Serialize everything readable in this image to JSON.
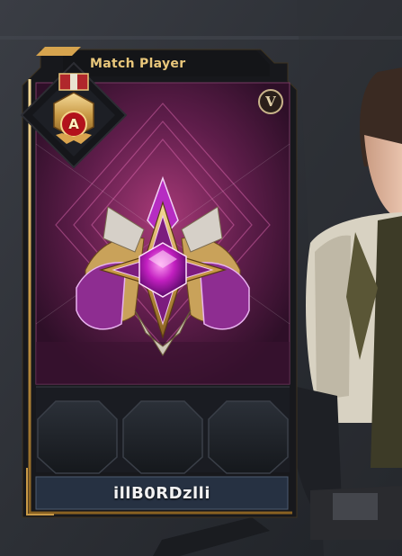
{
  "card": {
    "title": "Match Player",
    "player_name": "illB0RDzlli",
    "version_badge": "V",
    "medal_grade": "A"
  },
  "slots": [
    "empty",
    "empty",
    "empty"
  ],
  "icons": {
    "medal": "rank-medal-icon",
    "emblem": "purple-gem-emblem-icon",
    "version": "v-badge-icon"
  },
  "colors": {
    "accent_gold": "#e9c77b",
    "card_purple": "#5a1e48",
    "frame_dark": "#17181c"
  }
}
